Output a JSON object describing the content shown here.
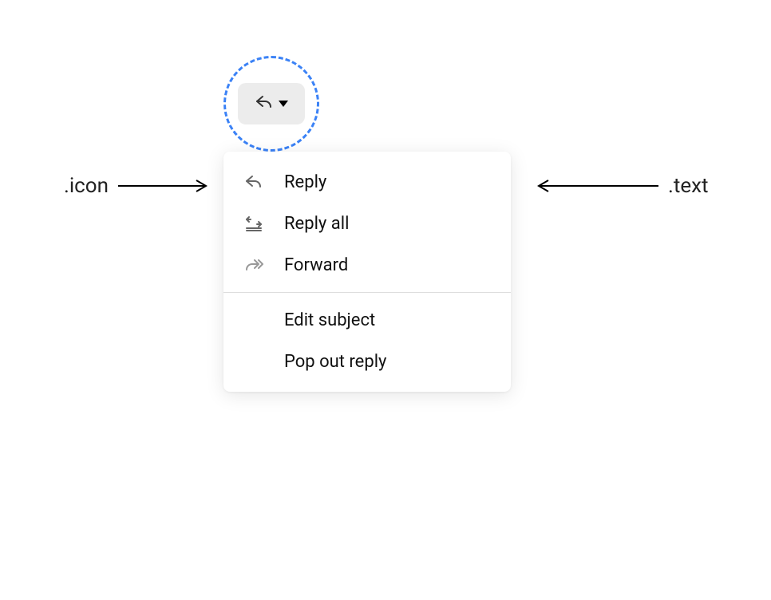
{
  "annotations": {
    "icon_label": ".icon",
    "text_label": ".text"
  },
  "trigger": {
    "icon": "reply-icon",
    "dropdown": "chevron-down-icon"
  },
  "menu": {
    "items": [
      {
        "icon": "reply-icon",
        "label": "Reply"
      },
      {
        "icon": "reply-all-icon",
        "label": "Reply all"
      },
      {
        "icon": "forward-icon",
        "label": "Forward"
      }
    ],
    "divider": true,
    "secondary_items": [
      {
        "label": "Edit subject"
      },
      {
        "label": "Pop out reply"
      }
    ]
  }
}
